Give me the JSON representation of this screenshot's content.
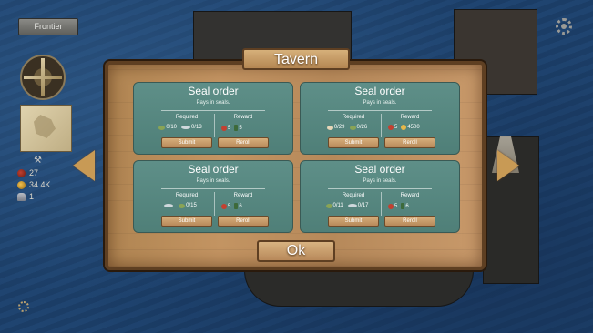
{
  "hud": {
    "frontier_label": "Frontier",
    "resources": [
      {
        "icon": "seal-icon",
        "value": "27"
      },
      {
        "icon": "coin-icon",
        "value": "34.4K"
      },
      {
        "icon": "population-icon",
        "value": "1"
      }
    ]
  },
  "tavern": {
    "title": "Tavern",
    "ok_label": "Ok",
    "orders": [
      {
        "title": "Seal order",
        "subtitle": "Pays in seals.",
        "required_label": "Required",
        "reward_label": "Reward",
        "required": [
          {
            "icon": "herb-icon",
            "value": "0/10"
          },
          {
            "icon": "fish-icon",
            "value": "0/13"
          }
        ],
        "rewards": [
          {
            "icon": "seal-icon",
            "value": "5"
          },
          {
            "icon": "bottle-icon",
            "value": "5"
          }
        ],
        "submit_label": "Submit",
        "reroll_label": "Reroll"
      },
      {
        "title": "Seal order",
        "subtitle": "Pays in seals.",
        "required_label": "Required",
        "reward_label": "Reward",
        "required": [
          {
            "icon": "clam-icon",
            "value": "0/29"
          },
          {
            "icon": "herb-icon",
            "value": "0/26"
          }
        ],
        "rewards": [
          {
            "icon": "seal-icon",
            "value": "5"
          },
          {
            "icon": "coin-icon",
            "value": "4500"
          }
        ],
        "submit_label": "Submit",
        "reroll_label": "Reroll"
      },
      {
        "title": "Seal order",
        "subtitle": "Pays in seals.",
        "required_label": "Required",
        "reward_label": "Reward",
        "required": [
          {
            "icon": "fish-icon",
            "value": ""
          },
          {
            "icon": "herb-icon",
            "value": "0/15"
          }
        ],
        "rewards": [
          {
            "icon": "seal-icon",
            "value": "5"
          },
          {
            "icon": "bottle-icon",
            "value": "6"
          }
        ],
        "submit_label": "Submit",
        "reroll_label": "Reroll"
      },
      {
        "title": "Seal order",
        "subtitle": "Pays in seals.",
        "required_label": "Required",
        "reward_label": "Reward",
        "required": [
          {
            "icon": "herb-icon",
            "value": "0/11"
          },
          {
            "icon": "fish-icon",
            "value": "0/17"
          }
        ],
        "rewards": [
          {
            "icon": "seal-icon",
            "value": "5"
          },
          {
            "icon": "bottle-icon",
            "value": "6"
          }
        ],
        "submit_label": "Submit",
        "reroll_label": "Reroll"
      }
    ]
  }
}
